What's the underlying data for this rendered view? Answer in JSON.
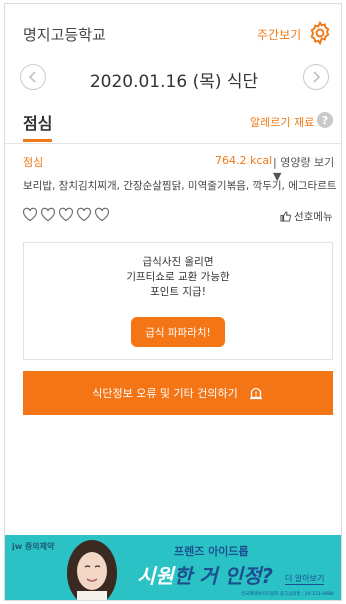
{
  "header": {
    "school_name": "명지고등학교",
    "weekly_view": "주간보기",
    "settings_icon": "gear-icon"
  },
  "date_nav": {
    "title": "2020.01.16 (목) 식단",
    "prev_icon": "chevron-left-icon",
    "next_icon": "chevron-right-icon"
  },
  "meal": {
    "tab_label": "점심",
    "allergy_label": "알레르기 재료",
    "help_label": "?",
    "name": "점심",
    "kcal": "764.2 kcal",
    "nutrition_label": "| 영양량 보기 ▼",
    "menu": "보리밥, 참치김치찌개, 간장순살찜닭, 미역줄기볶음, 깍두기, 에그타르트"
  },
  "rating": {
    "hearts_total": 5,
    "hearts_filled": 0,
    "like_label": "선호메뉴"
  },
  "promo": {
    "line1": "급식사진 올리면",
    "line2": "기프티쇼로 교환 가능한",
    "line3": "포인트 지급!",
    "button_label": "급식 파파라치!"
  },
  "report_button": {
    "label": "식단정보 오류 및 기타 건의하기"
  },
  "ad": {
    "brand": "jw 중외제약",
    "subtitle": "프렌즈 아이드롭",
    "title_highlight": "시원",
    "title_rest": "한 거 인정?",
    "more_label": "더 알아보기",
    "fine_print": "한국제약바이오협회 광고심의필 : 20-121-0888",
    "bg_color": "#2bc2c5"
  },
  "colors": {
    "accent": "#f47516",
    "text": "#333333"
  }
}
